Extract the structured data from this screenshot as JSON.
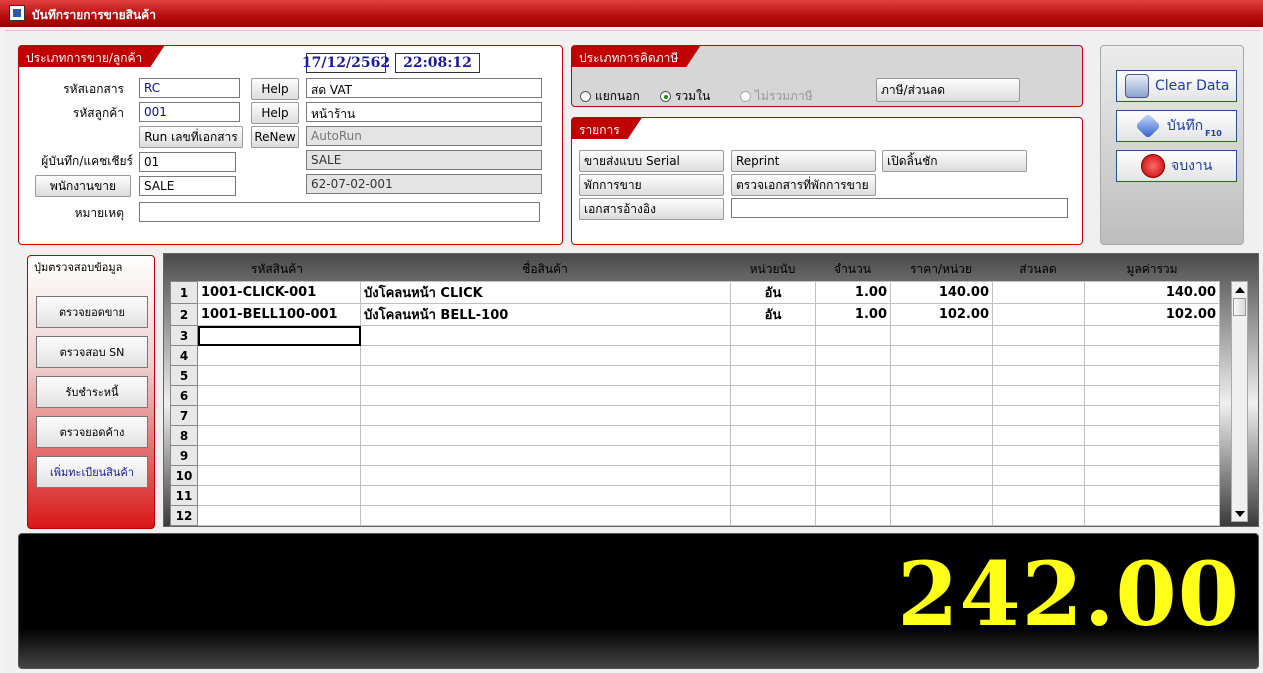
{
  "window": {
    "title": "บันทึกรายการขายสินค้า"
  },
  "sale_panel": {
    "tab": "ประเภทการขาย/ลูกค้า",
    "date": "17/12/2562",
    "time": "22:08:12",
    "labels": {
      "doc": "รหัสเอกสาร",
      "customer": "รหัสลูกค้า",
      "cashier": "ผู้บันทึก/แคชเชียร์",
      "note": "หมายเหตุ"
    },
    "doc_code": "RC",
    "customer_code": "001",
    "cashier_code": "01",
    "salesperson_button": "พนักงานขาย",
    "salesperson_code": "SALE",
    "help1": "Help",
    "help2": "Help",
    "run_button": "Run เลขที่เอกสาร",
    "renew_button": "ReNew",
    "doc_type": "สด VAT",
    "customer_name": "หน้าร้าน",
    "autorun": "AutoRun",
    "salesperson_name": "SALE",
    "doc_number": "62-07-02-001",
    "note": ""
  },
  "tax_panel": {
    "tab": "ประเภทการคิดภาษี",
    "options": [
      "แยกนอก",
      "รวมใน",
      "ไม่รวมภาษี"
    ],
    "selected": "รวมใน",
    "tax_discount_button": "ภาษี/ส่วนลด"
  },
  "items_panel": {
    "tab": "รายการ",
    "buttons": {
      "serial": "ขายส่งแบบ Serial",
      "reprint": "Reprint",
      "open_drawer": "เปิดลิ้นชัก",
      "pause_sale": "พักการขาย",
      "check_paused": "ตรวจเอกสารที่พักการขาย",
      "reference": "เอกสารอ้างอิง"
    },
    "reference_value": ""
  },
  "actions": {
    "clear": "Clear Data",
    "save": "บันทึก",
    "save_key": "F10",
    "exit": "จบงาน"
  },
  "left_nav": {
    "title": "ปุ่มตรวจสอบข้อมูล",
    "buttons": [
      "ตรวจยอดขาย",
      "ตรวจสอบ SN",
      "รับชำระหนี้",
      "ตรวจยอดค้าง",
      "เพิ่มทะเบียนสินค้า"
    ]
  },
  "grid": {
    "headers": [
      "รหัสสินค้า",
      "ชื่อสินค้า",
      "หน่วยนับ",
      "จำนวน",
      "ราคา/หน่วย",
      "ส่วนลด",
      "มูลค่ารวม"
    ],
    "rows": [
      {
        "no": "1",
        "code": "1001-CLICK-001",
        "name": "บังโคลนหน้า CLICK",
        "unit": "อัน",
        "qty": "1.00",
        "price": "140.00",
        "discount": "",
        "total": "140.00"
      },
      {
        "no": "2",
        "code": "1001-BELL100-001",
        "name": "บังโคลนหน้า BELL-100",
        "unit": "อัน",
        "qty": "1.00",
        "price": "102.00",
        "discount": "",
        "total": "102.00"
      },
      {
        "no": "3",
        "code": "",
        "name": "",
        "unit": "",
        "qty": "",
        "price": "",
        "discount": "",
        "total": ""
      },
      {
        "no": "4",
        "code": "",
        "name": "",
        "unit": "",
        "qty": "",
        "price": "",
        "discount": "",
        "total": ""
      },
      {
        "no": "5",
        "code": "",
        "name": "",
        "unit": "",
        "qty": "",
        "price": "",
        "discount": "",
        "total": ""
      },
      {
        "no": "6",
        "code": "",
        "name": "",
        "unit": "",
        "qty": "",
        "price": "",
        "discount": "",
        "total": ""
      },
      {
        "no": "7",
        "code": "",
        "name": "",
        "unit": "",
        "qty": "",
        "price": "",
        "discount": "",
        "total": ""
      },
      {
        "no": "8",
        "code": "",
        "name": "",
        "unit": "",
        "qty": "",
        "price": "",
        "discount": "",
        "total": ""
      },
      {
        "no": "9",
        "code": "",
        "name": "",
        "unit": "",
        "qty": "",
        "price": "",
        "discount": "",
        "total": ""
      },
      {
        "no": "10",
        "code": "",
        "name": "",
        "unit": "",
        "qty": "",
        "price": "",
        "discount": "",
        "total": ""
      },
      {
        "no": "11",
        "code": "",
        "name": "",
        "unit": "",
        "qty": "",
        "price": "",
        "discount": "",
        "total": ""
      },
      {
        "no": "12",
        "code": "",
        "name": "",
        "unit": "",
        "qty": "",
        "price": "",
        "discount": "",
        "total": ""
      }
    ]
  },
  "grand_total": "242.00",
  "colors": {
    "accent": "#c00000",
    "total_text": "#ffff1a",
    "total_bg": "#000000"
  },
  "icons": {
    "clear": "recycle-bin-icon",
    "save": "save-diamond-icon",
    "exit": "stop-hand-icon"
  }
}
